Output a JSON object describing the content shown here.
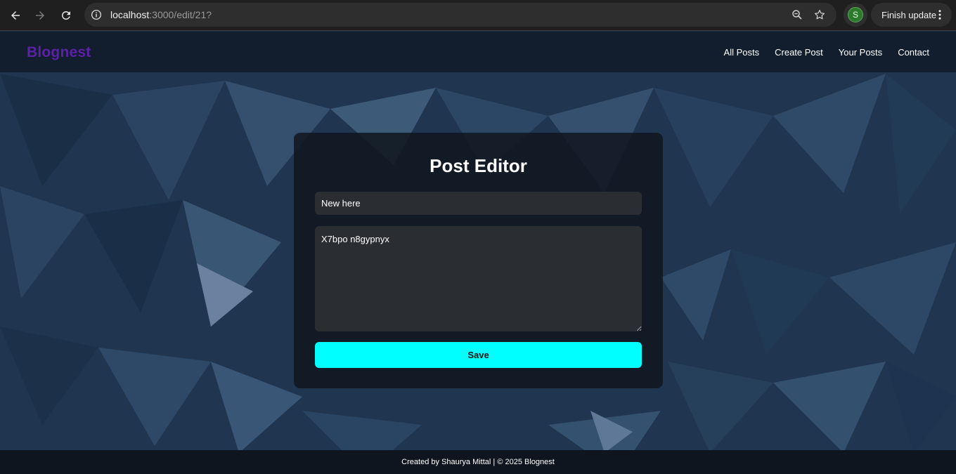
{
  "browser": {
    "url_host": "localhost",
    "url_path": ":3000/edit/21?",
    "profile_initial": "S",
    "finish_update_label": "Finish update"
  },
  "site": {
    "brand": "Blognest",
    "nav": [
      "All Posts",
      "Create Post",
      "Your Posts",
      "Contact"
    ]
  },
  "editor": {
    "heading": "Post Editor",
    "title_value": "New here",
    "body_value": "X7bpo n8gypnyx",
    "save_label": "Save"
  },
  "footer": {
    "text": "Created by Shaurya Mittal | © 2025 Blognest"
  },
  "colors": {
    "brand": "#5b21a6",
    "save_button": "#00ffff",
    "card_bg": "#10161e"
  }
}
